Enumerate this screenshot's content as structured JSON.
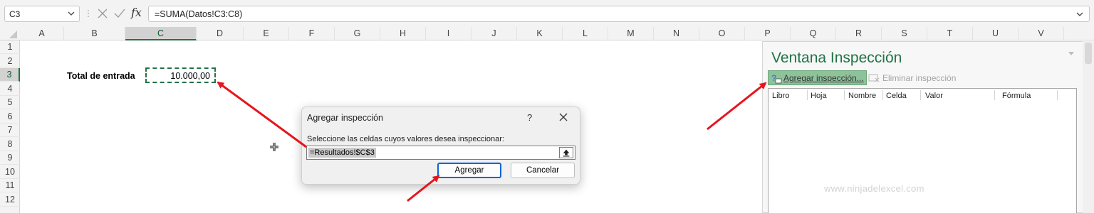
{
  "formula_bar": {
    "name_box": "C3",
    "separator": "⋮",
    "fx_label": "fx",
    "formula": "=SUMA(Datos!C3:C8)"
  },
  "columns": [
    "A",
    "B",
    "C",
    "D",
    "E",
    "F",
    "G",
    "H",
    "I",
    "J",
    "K",
    "L",
    "M",
    "N",
    "O",
    "P",
    "Q",
    "R",
    "S",
    "T",
    "U",
    "V"
  ],
  "active_column": "C",
  "rows": [
    "1",
    "2",
    "3",
    "4",
    "5",
    "6",
    "7",
    "8",
    "9",
    "10",
    "11",
    "12"
  ],
  "active_row": "3",
  "cells": {
    "b3_label": "Total de entrada",
    "c3_value": "10.000,00"
  },
  "dialog": {
    "title": "Agregar inspección",
    "help": "?",
    "prompt": "Seleccione las celdas cuyos valores desea inspeccionar:",
    "reference": "=Resultados!$C$3",
    "add_label": "Agregar",
    "cancel_label": "Cancelar"
  },
  "watch_window": {
    "title": "Ventana Inspección",
    "add_label": "Agregar inspección...",
    "delete_label": "Eliminar inspección",
    "columns": [
      "Libro",
      "Hoja",
      "Nombre",
      "Celda",
      "Valor",
      "Fórmula"
    ],
    "watermark": "www.ninjadelexcel.com"
  },
  "colors": {
    "excel_green": "#217346",
    "annotation_red": "#e8141c",
    "focus_blue": "#0a64d8"
  }
}
